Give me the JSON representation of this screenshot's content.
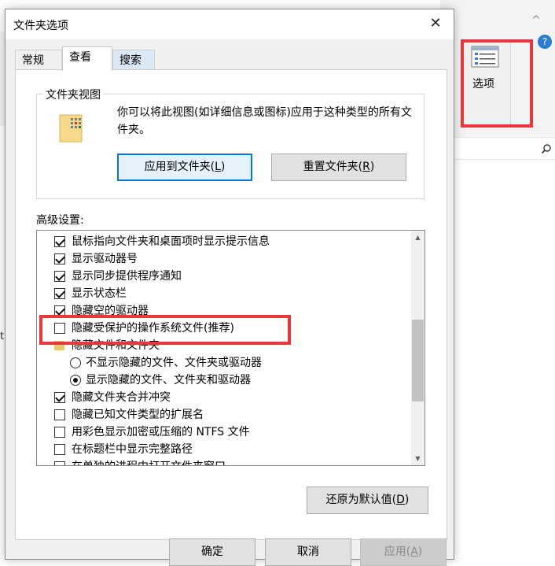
{
  "background": {
    "options_label": "选项",
    "left_edge_char": "t",
    "chevron": "^",
    "help": "?"
  },
  "dialog": {
    "title": "文件夹选项",
    "close_glyph": "✕",
    "tabs": [
      {
        "label": "常规"
      },
      {
        "label": "查看"
      },
      {
        "label": "搜索"
      }
    ],
    "folder_views": {
      "legend": "文件夹视图",
      "description": "你可以将此视图(如详细信息或图标)应用于这种类型的所有文件夹。",
      "apply_button_pre": "应用到文件夹(",
      "apply_button_key": "L",
      "apply_button_post": ")",
      "reset_button_pre": "重置文件夹(",
      "reset_button_key": "R",
      "reset_button_post": ")"
    },
    "advanced_label": "高级设置:",
    "settings": [
      {
        "label": "鼠标指向文件夹和桌面项时显示提示信息",
        "type": "checkbox",
        "checked": true
      },
      {
        "label": "显示驱动器号",
        "type": "checkbox",
        "checked": true
      },
      {
        "label": "显示同步提供程序通知",
        "type": "checkbox",
        "checked": true
      },
      {
        "label": "显示状态栏",
        "type": "checkbox",
        "checked": true
      },
      {
        "label": "隐藏空的驱动器",
        "type": "checkbox",
        "checked": true
      },
      {
        "label": "隐藏受保护的操作系统文件(推荐)",
        "type": "checkbox",
        "checked": false
      },
      {
        "label": "隐藏文件和文件夹",
        "type": "folder"
      },
      {
        "label": "不显示隐藏的文件、文件夹或驱动器",
        "type": "radio",
        "checked": false
      },
      {
        "label": "显示隐藏的文件、文件夹和驱动器",
        "type": "radio",
        "checked": true
      },
      {
        "label": "隐藏文件夹合并冲突",
        "type": "checkbox",
        "checked": true
      },
      {
        "label": "隐藏已知文件类型的扩展名",
        "type": "checkbox",
        "checked": false
      },
      {
        "label": "用彩色显示加密或压缩的 NTFS 文件",
        "type": "checkbox",
        "checked": false
      },
      {
        "label": "在标题栏中显示完整路径",
        "type": "checkbox",
        "checked": false
      },
      {
        "label": "在单独的进程中打开文件夹窗口",
        "type": "checkbox",
        "checked": false
      }
    ],
    "restore_button_pre": "还原为默认值(",
    "restore_button_key": "D",
    "restore_button_post": ")",
    "ok_button": "确定",
    "cancel_button": "取消",
    "apply_button_pre": "应用(",
    "apply_button_key": "A",
    "apply_button_post": ")"
  },
  "colors": {
    "highlight": "#e8383b",
    "accent": "#0078d7"
  }
}
